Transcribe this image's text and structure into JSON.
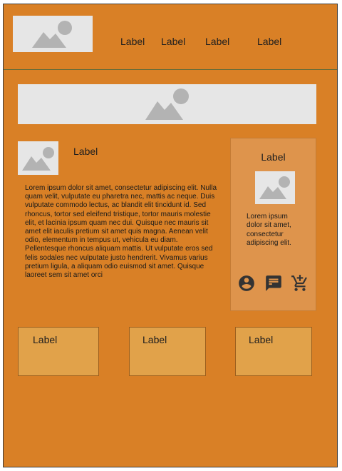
{
  "header": {
    "logo_icon": "image-placeholder-icon",
    "nav": [
      "Label",
      "Label",
      "Label",
      "Label"
    ]
  },
  "banner": {
    "icon": "image-placeholder-icon"
  },
  "article": {
    "thumb_icon": "image-placeholder-icon",
    "title": "Label",
    "body": "Lorem ipsum dolor sit amet, consectetur adipiscing elit. Nulla quam velit, vulputate eu pharetra nec, mattis ac neque. Duis vulputate commodo lectus, ac blandit elit tincidunt id. Sed rhoncus, tortor sed eleifend tristique, tortor mauris molestie elit, et lacinia ipsum quam nec dui. Quisque nec mauris sit amet elit iaculis pretium sit amet quis magna. Aenean velit odio, elementum in tempus ut, vehicula eu diam. Pellentesque rhoncus aliquam mattis. Ut vulputate eros sed felis sodales nec vulputate justo hendrerit. Vivamus varius pretium ligula, a aliquam odio euismod sit amet. Quisque laoreet sem sit amet orci"
  },
  "sidebar": {
    "title": "Label",
    "image_icon": "image-placeholder-icon",
    "text": "Lorem ipsum dolor sit amet, consectetur adipiscing elit.",
    "icons": [
      "account-circle-icon",
      "message-list-icon",
      "add-to-cart-icon"
    ]
  },
  "cards": [
    "Label",
    "Label",
    "Label"
  ],
  "colors": {
    "page": "#d98026",
    "sidebar": "#de944c",
    "card": "#e1a24a",
    "placeholder": "#e6e6e6",
    "placeholder_glyph": "#b3b3b3"
  }
}
